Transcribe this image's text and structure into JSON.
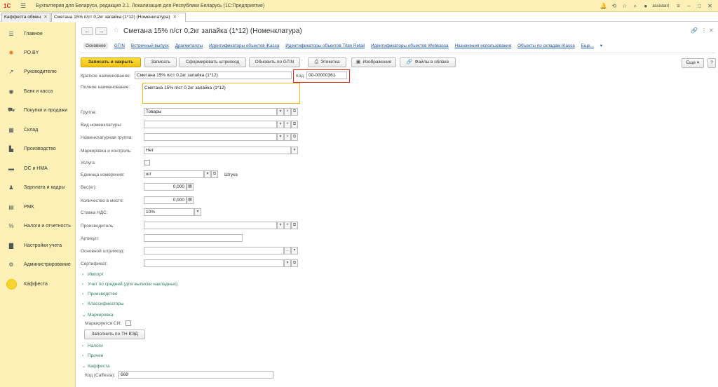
{
  "app": {
    "title": "Бухгалтерия для Беларуси, редакция 2.1. Локализация для Республики Беларусь   (1С:Предприятие)",
    "logo": "1С",
    "user": "assistant",
    "accent": "#fbf0b5"
  },
  "tabs": [
    {
      "label": "Каффеста обмен"
    },
    {
      "label": "Сметана 15% п/ст 0,2кг запайка (1*12) (Номенклатура)"
    }
  ],
  "sidebar": {
    "items": [
      {
        "label": "Главное",
        "icon": "menu-lines-icon"
      },
      {
        "label": "PO.BY",
        "icon": "asterisk-icon"
      },
      {
        "label": "Руководителю",
        "icon": "trend-icon"
      },
      {
        "label": "Банк и касса",
        "icon": "coin-icon"
      },
      {
        "label": "Покупки и продажи",
        "icon": "cart-icon"
      },
      {
        "label": "Склад",
        "icon": "grid-icon"
      },
      {
        "label": "Производство",
        "icon": "factory-icon"
      },
      {
        "label": "ОС и НМА",
        "icon": "truck-icon"
      },
      {
        "label": "Зарплата и кадры",
        "icon": "person-icon"
      },
      {
        "label": "РМК",
        "icon": "register-icon"
      },
      {
        "label": "Налоги и отчетность",
        "icon": "tax-icon"
      },
      {
        "label": "Настройки учета",
        "icon": "book-icon"
      },
      {
        "label": "Администрирование",
        "icon": "gear-icon"
      },
      {
        "label": "Каффеста",
        "icon": "yellow-circle-icon"
      }
    ]
  },
  "header": {
    "title": "Сметана 15% п/ст 0,2кг запайка (1*12) (Номенклатура)"
  },
  "navlinks": [
    "Основное",
    "GTIN",
    "Встречный выпуск",
    "Драгметаллы",
    "Идентификаторы объектов iKassa",
    "Идентификаторы объектов Titan Retail",
    "Идентификаторы объектов Webkassa",
    "Назначения использования",
    "Объекты по складам iKassa",
    "Еще..."
  ],
  "toolbar": {
    "save_close": "Записать и закрыть",
    "save": "Записать",
    "make_barcode": "Сформировать штрихкод",
    "update_gtin": "Обновить по GTIN",
    "label": "Этикетка",
    "images": "Изображения",
    "cloud_files": "Файлы в облаке",
    "more": "Еще",
    "help": "?"
  },
  "form": {
    "short_name_label": "Краткое наименование:",
    "short_name": "Сметана 15% п/ст 0,2кг запайка (1*12)",
    "kod_label": "Код:",
    "kod": "00-00000361",
    "full_name_label": "Полное наименование:",
    "full_name": "Сметана 15% п/ст 0,2кг запайка (1*12)",
    "group_label": "Группа:",
    "group": "Товары",
    "kind_label": "Вид номенклатуры:",
    "kind": "",
    "nom_group_label": "Номенклатурная группа:",
    "nom_group": "",
    "marking_label": "Маркировка и контроль:",
    "marking": "Нет",
    "service_label": "Услуга:",
    "unit_label": "Единица измерения:",
    "unit": "шт",
    "unit_name": "Штука",
    "weight_label": "Вес(кг):",
    "weight": "0,000",
    "qty_label": "Количество в месте:",
    "qty": "0,000",
    "vat_label": "Ставка НДС:",
    "vat": "10%",
    "producer_label": "Производитель:",
    "producer": "",
    "article_label": "Артикул:",
    "article": "",
    "barcode_label": "Основной штрихкод:",
    "barcode": "",
    "cert_label": "Сертификат:",
    "cert": ""
  },
  "groups": [
    {
      "label": "Импорт",
      "expanded": false
    },
    {
      "label": "Учет по средней (для выписки накладных)",
      "expanded": false
    },
    {
      "label": "Производство",
      "expanded": false
    },
    {
      "label": "Классификаторы",
      "expanded": false
    },
    {
      "label": "Маркировка",
      "expanded": true
    },
    {
      "label": "Налоги",
      "expanded": false
    },
    {
      "label": "Прочее",
      "expanded": false
    },
    {
      "label": "Каффеста",
      "expanded": true
    }
  ],
  "marking_section": {
    "marked_label": "Маркируется СИ:",
    "fill_button": "Заполнить по ТН ВЭД"
  },
  "caffesta_section": {
    "code_label": "Код (Caffesta):",
    "code": "668"
  }
}
